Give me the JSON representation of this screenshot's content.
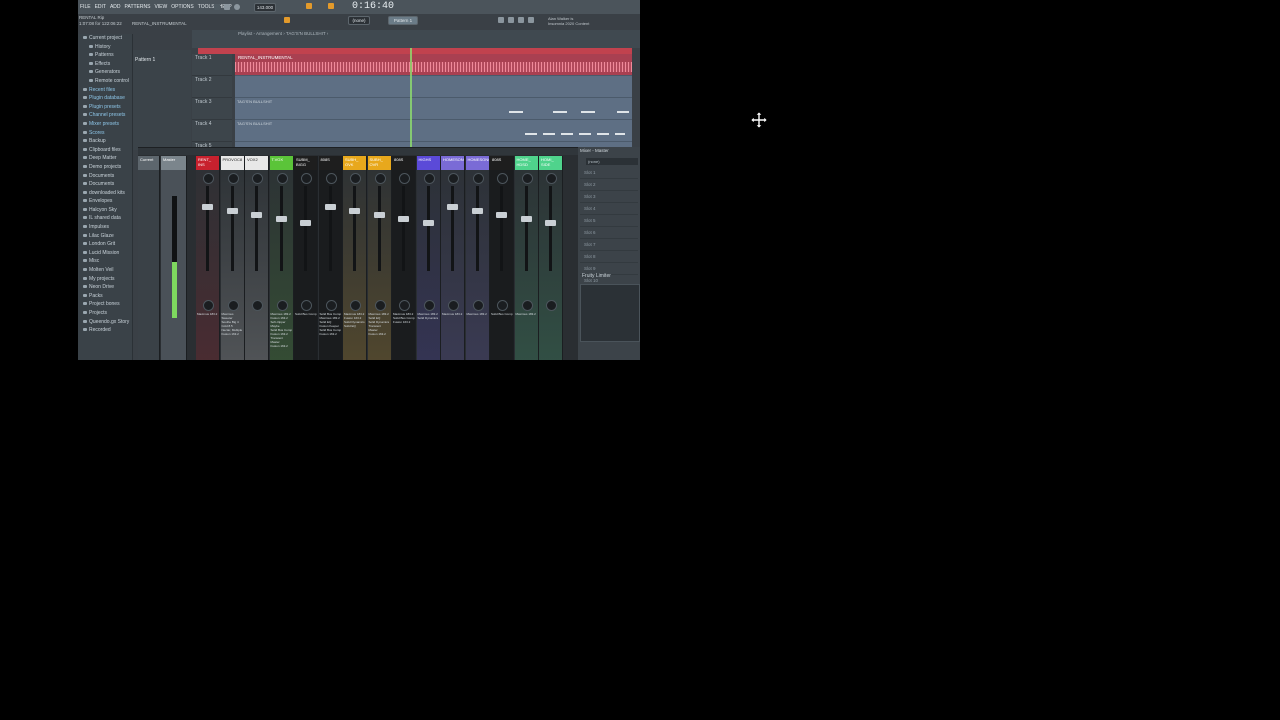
{
  "menu": [
    "FILE",
    "EDIT",
    "ADD",
    "PATTERNS",
    "VIEW",
    "OPTIONS",
    "TOOLS",
    "HELP"
  ],
  "hint": {
    "line1": "RENTAL Rip",
    "line2": "1:07:08 for 122:06:22"
  },
  "project_label": "RENTAL_INSTRUMENTAL",
  "tempo": "143.000",
  "time": "0:16:40",
  "pattern_selector": "Pattern 1",
  "snap": "(none)",
  "news": {
    "line1": "Alan Walker is",
    "line2": "Insomnia 2020 Content"
  },
  "playlist_title": "Playlist - Arrangement › TAG'S'N BULLSHIT ›",
  "browser": {
    "items": [
      {
        "label": "Current project",
        "sub": false
      },
      {
        "label": "History",
        "sub": true
      },
      {
        "label": "Patterns",
        "sub": true
      },
      {
        "label": "Effects",
        "sub": true
      },
      {
        "label": "Generators",
        "sub": true
      },
      {
        "label": "Remote control",
        "sub": true
      },
      {
        "label": "Recent files",
        "sub": false
      },
      {
        "label": "Plugin database",
        "sub": false
      },
      {
        "label": "Plugin presets",
        "sub": false
      },
      {
        "label": "Channel presets",
        "sub": false
      },
      {
        "label": "Mixer presets",
        "sub": false
      },
      {
        "label": "Scores",
        "sub": false
      },
      {
        "label": "Backup",
        "sub": false
      },
      {
        "label": "Clipboard files",
        "sub": false
      },
      {
        "label": "Deep Matter",
        "sub": false
      },
      {
        "label": "Demo projects",
        "sub": false
      },
      {
        "label": "Documents",
        "sub": false
      },
      {
        "label": "Documents",
        "sub": false
      },
      {
        "label": "downloaded kits",
        "sub": false
      },
      {
        "label": "Envelopes",
        "sub": false
      },
      {
        "label": "Halcyon Sky",
        "sub": false
      },
      {
        "label": "IL shared data",
        "sub": false
      },
      {
        "label": "Impulses",
        "sub": false
      },
      {
        "label": "Lilac Glaze",
        "sub": false
      },
      {
        "label": "London Grit",
        "sub": false
      },
      {
        "label": "Lucid Mission",
        "sub": false
      },
      {
        "label": "Misc",
        "sub": false
      },
      {
        "label": "Molten Veil",
        "sub": false
      },
      {
        "label": "My projects",
        "sub": false
      },
      {
        "label": "Neon Drive",
        "sub": false
      },
      {
        "label": "Packs",
        "sub": false
      },
      {
        "label": "Project bones",
        "sub": false
      },
      {
        "label": "Projects",
        "sub": false
      },
      {
        "label": "Queendo.gx Story",
        "sub": false
      },
      {
        "label": "Recorded",
        "sub": false
      }
    ]
  },
  "pattern_label": "Pattern 1",
  "tracks": [
    "Track 1",
    "Track 2",
    "Track 3",
    "Track 4",
    "Track 5"
  ],
  "clip_main": "RENTAL_INSTRUMENTAL",
  "clip_labels": [
    "TAG'S'N BULLSHIT",
    "TAG'S'N BULLSHIT"
  ],
  "mixer": {
    "current_label": "Current",
    "master_label": "Master",
    "strips": [
      {
        "name": "RENT_ INS",
        "color": "#c8212e",
        "fx": [
          "Maximus 183.2"
        ]
      },
      {
        "name": "PROVOC8",
        "color": "#e8e8e8",
        "fx": [
          "Maximus Sweeter",
          "Soothe Big 4",
          "Cold 8.5",
          "Nectar, Multiple",
          "Fusion 163.2"
        ]
      },
      {
        "name": "VOX2",
        "color": "#e8e8e8",
        "fx": []
      },
      {
        "name": "T.VOX",
        "color": "#5bc439",
        "fx": [
          "Maximus 183.2",
          "Fusion 163.2",
          "Soft clipper",
          "Maybe",
          "Solid Bus Comp",
          "Fusion 163.2",
          "Transient Master",
          "Fusion 163.2"
        ]
      },
      {
        "name": "SUBM_ BIGG",
        "color": "#1e1e1e",
        "fx": [
          "Solid Bus Comp"
        ]
      },
      {
        "name": "808S",
        "color": "#1e1e1e",
        "fx": [
          "Solid Bus Comp",
          "Maximus 183.2",
          "Solid EQ",
          "Fusion Keeper",
          "Solid Bus Comp",
          "Fusion 163.2"
        ]
      },
      {
        "name": "SUBH_ OVK",
        "color": "#e8a81c",
        "fx": [
          "Maximus 183.2",
          "Fusion 163.2",
          "Solid Dynamics",
          "Solid EQ"
        ]
      },
      {
        "name": "SUBH_ OVR",
        "color": "#e8a81c",
        "fx": [
          "Maximus 183.2",
          "Solid EQ",
          "Solid Dynamics",
          "Transient Master",
          "Fusion 163.2"
        ]
      },
      {
        "name": "808S",
        "color": "#1e1e1e",
        "fx": [
          "Maximus 183.2",
          "Solid Bus Comp",
          "Fusion 163.2"
        ]
      },
      {
        "name": "HIGHS",
        "color": "#5b4ad8",
        "fx": [
          "Maximus 183.2",
          "Solid Dynamics"
        ]
      },
      {
        "name": "HOMESONG",
        "color": "#7a6bd6",
        "fx": [
          "Maximus 183.2"
        ]
      },
      {
        "name": "HOMESONG",
        "color": "#7a6bd6",
        "fx": [
          "Maximus 183.2"
        ]
      },
      {
        "name": "808S",
        "color": "#1e1e1e",
        "fx": [
          "Solid Bus Comp"
        ]
      },
      {
        "name": "HOME_ HDSD",
        "color": "#4fd38c",
        "fx": [
          "Maximus 183.2"
        ]
      },
      {
        "name": "HOMI_ SIDE",
        "color": "#4fd38c",
        "fx": []
      }
    ]
  },
  "mixer_slots": {
    "title": "Mixer - Master",
    "input": "(none)",
    "slots": [
      "Slot 1",
      "Slot 2",
      "Slot 3",
      "Slot 4",
      "Slot 5",
      "Slot 6",
      "Slot 7",
      "Slot 8",
      "Slot 9",
      "Slot 10"
    ],
    "limiter": "Fruity Limiter"
  }
}
